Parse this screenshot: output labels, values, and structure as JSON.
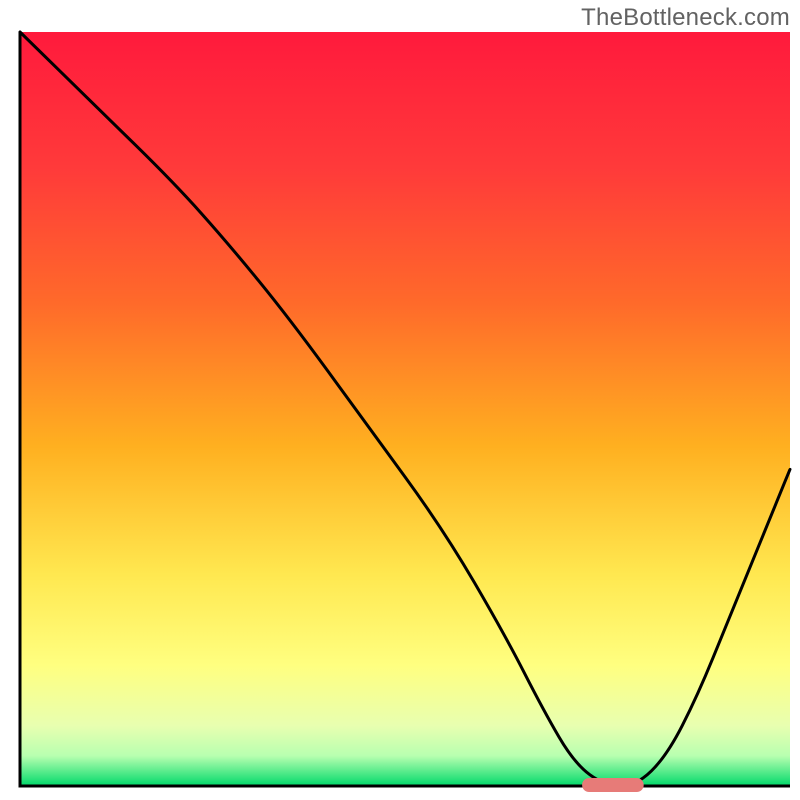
{
  "chart_data": {
    "type": "line",
    "x_range": [
      0,
      100
    ],
    "y_range": [
      0,
      100
    ],
    "series": [
      {
        "name": "bottleneck-curve",
        "x": [
          0,
          10,
          20,
          27,
          35,
          45,
          55,
          63,
          68,
          72,
          76,
          80,
          84,
          88,
          92,
          96,
          100
        ],
        "y": [
          100,
          90,
          80,
          72,
          62,
          48,
          34,
          20,
          10,
          3,
          0,
          0,
          4,
          12,
          22,
          32,
          42
        ]
      }
    ],
    "marker": {
      "name": "optimal-range",
      "x_start": 73,
      "x_end": 81,
      "y": 0
    },
    "title": "",
    "xlabel": "",
    "ylabel": ""
  },
  "watermark": "TheBottleneck.com",
  "colors": {
    "gradient_top": "#ff1a3c",
    "gradient_upper_mid": "#ff6a2a",
    "gradient_mid": "#ffb020",
    "gradient_lower_mid": "#ffe850",
    "gradient_yellow": "#ffff80",
    "gradient_bottom": "#00d96a",
    "marker": "#e77b78",
    "curve": "#000000",
    "axis": "#000000"
  }
}
